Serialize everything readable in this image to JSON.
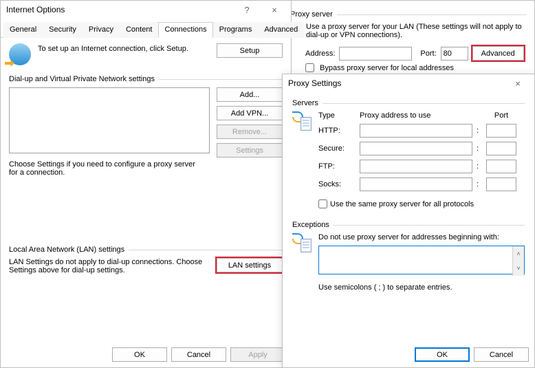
{
  "internet_options": {
    "title": "Internet Options",
    "help_glyph": "?",
    "close_glyph": "×",
    "tabs": {
      "general": "General",
      "security": "Security",
      "privacy": "Privacy",
      "content": "Content",
      "connections": "Connections",
      "programs": "Programs",
      "advanced": "Advanced"
    },
    "setup_text": "To set up an Internet connection, click Setup.",
    "setup_btn": "Setup",
    "dialup_legend": "Dial-up and Virtual Private Network settings",
    "add_btn": "Add...",
    "add_vpn_btn": "Add VPN...",
    "remove_btn": "Remove...",
    "settings_btn": "Settings",
    "choose_settings": "Choose Settings if you need to configure a proxy server for a connection.",
    "lan_legend": "Local Area Network (LAN) settings",
    "lan_text": "LAN Settings do not apply to dial-up connections. Choose Settings above for dial-up settings.",
    "lan_btn": "LAN settings",
    "ok": "OK",
    "cancel": "Cancel",
    "apply": "Apply"
  },
  "proxy_panel": {
    "legend": "Proxy server",
    "use_proxy_label": "Use a proxy server for your LAN (These settings will not apply to dial-up or VPN connections).",
    "address_label": "Address:",
    "address_value": "",
    "port_label": "Port:",
    "port_value": "80",
    "advanced_btn": "Advanced",
    "bypass_label": "Bypass proxy server for local addresses"
  },
  "proxy_settings": {
    "title": "Proxy Settings",
    "close_glyph": "×",
    "servers_legend": "Servers",
    "type_hdr": "Type",
    "addr_hdr": "Proxy address to use",
    "port_hdr": "Port",
    "rows": {
      "http": {
        "label": "HTTP:",
        "addr": "",
        "port": ""
      },
      "secure": {
        "label": "Secure:",
        "addr": "",
        "port": ""
      },
      "ftp": {
        "label": "FTP:",
        "addr": "",
        "port": ""
      },
      "socks": {
        "label": "Socks:",
        "addr": "",
        "port": ""
      }
    },
    "same_label": "Use the same proxy server for all protocols",
    "exceptions_legend": "Exceptions",
    "exceptions_text": "Do not use proxy server for addresses beginning with:",
    "exceptions_value": "",
    "exceptions_hint": "Use semicolons ( ; ) to separate entries.",
    "ok": "OK",
    "cancel": "Cancel"
  }
}
